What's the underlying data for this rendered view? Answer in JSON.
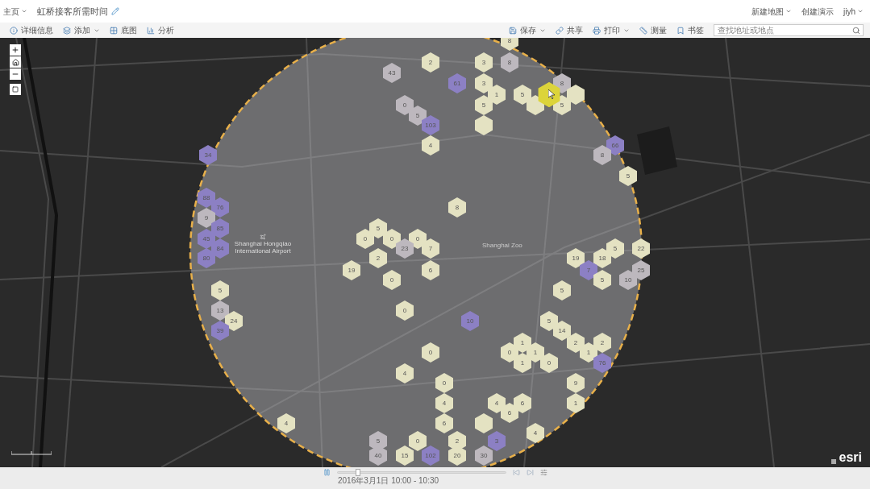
{
  "header": {
    "breadcrumb": "主页",
    "title": "虹桥接客所需时间",
    "menu": [
      {
        "label": "新建地图",
        "dropdown": true
      },
      {
        "label": "创建演示",
        "dropdown": false
      },
      {
        "label": "jiyh",
        "dropdown": true
      }
    ]
  },
  "toolbar": {
    "left": [
      {
        "label": "详细信息",
        "dropdown": false
      },
      {
        "label": "添加",
        "dropdown": true
      },
      {
        "label": "底图",
        "dropdown": false
      },
      {
        "label": "分析",
        "dropdown": false
      }
    ],
    "right": [
      {
        "label": "保存",
        "dropdown": true
      },
      {
        "label": "共享",
        "dropdown": false
      },
      {
        "label": "打印",
        "dropdown": true
      },
      {
        "label": "测量",
        "dropdown": false
      },
      {
        "label": "书签",
        "dropdown": false
      }
    ],
    "search": {
      "placeholder": "查找地址或地点"
    }
  },
  "map": {
    "labels": [
      {
        "text": "Shanghai Hongqiao International Airport",
        "kind": "poi"
      },
      {
        "text": "Shanghai Zoo",
        "kind": "small"
      }
    ],
    "hexes": [
      {
        "value": "8",
        "color": "#e4e2c2",
        "selected": false
      },
      {
        "value": "2",
        "color": "#e4e2c2",
        "selected": false
      },
      {
        "value": "3",
        "color": "#e4e2c2",
        "selected": false
      },
      {
        "value": "8",
        "color": "#bdb8be",
        "selected": false
      },
      {
        "value": "43",
        "color": "#bdb8be",
        "selected": false
      },
      {
        "value": "61",
        "color": "#8c80c4",
        "selected": false
      },
      {
        "value": "3",
        "color": "#e4e2c2",
        "selected": false
      },
      {
        "value": "8",
        "color": "#bdb8be",
        "selected": false
      },
      {
        "value": "1",
        "color": "#e4e2c2",
        "selected": false
      },
      {
        "value": "5",
        "color": "#e4e2c2",
        "selected": false
      },
      {
        "color": "#dcd43a",
        "selected": true
      },
      {
        "color": "#e4e2c2",
        "selected": false
      },
      {
        "value": "0",
        "color": "#bdb8be",
        "selected": false
      },
      {
        "value": "5",
        "color": "#e4e2c2",
        "selected": false
      },
      {
        "color": "#e4e2c2",
        "selected": false
      },
      {
        "value": "5",
        "color": "#e4e2c2",
        "selected": false
      },
      {
        "value": "5",
        "color": "#bdb8be",
        "selected": false
      },
      {
        "value": "103",
        "color": "#8c80c4",
        "selected": false
      },
      {
        "color": "#e4e2c2",
        "selected": false
      },
      {
        "value": "4",
        "color": "#e4e2c2",
        "selected": false
      },
      {
        "value": "66",
        "color": "#8c80c4",
        "selected": false
      },
      {
        "value": "34",
        "color": "#8c80c4",
        "selected": false
      },
      {
        "value": "8",
        "color": "#bdb8be",
        "selected": false
      },
      {
        "value": "5",
        "color": "#e4e2c2",
        "selected": false
      },
      {
        "value": "88",
        "color": "#8c80c4",
        "selected": false
      },
      {
        "value": "76",
        "color": "#8c80c4",
        "selected": false
      },
      {
        "value": "8",
        "color": "#e4e2c2",
        "selected": false
      },
      {
        "value": "9",
        "color": "#bdb8be",
        "selected": false
      },
      {
        "value": "85",
        "color": "#8c80c4",
        "selected": false
      },
      {
        "value": "5",
        "color": "#e4e2c2",
        "selected": false
      },
      {
        "value": "45",
        "color": "#8c80c4",
        "selected": false
      },
      {
        "value": "0",
        "color": "#e4e2c2",
        "selected": false
      },
      {
        "value": "0",
        "color": "#e4e2c2",
        "selected": false
      },
      {
        "value": "0",
        "color": "#e4e2c2",
        "selected": false
      },
      {
        "value": "84",
        "color": "#8c80c4",
        "selected": false
      },
      {
        "value": "23",
        "color": "#bdb8be",
        "selected": false
      },
      {
        "value": "7",
        "color": "#e4e2c2",
        "selected": false
      },
      {
        "value": "5",
        "color": "#e4e2c2",
        "selected": false
      },
      {
        "value": "22",
        "color": "#e4e2c2",
        "selected": false
      },
      {
        "value": "80",
        "color": "#8c80c4",
        "selected": false
      },
      {
        "value": "2",
        "color": "#e4e2c2",
        "selected": false
      },
      {
        "value": "19",
        "color": "#e4e2c2",
        "selected": false
      },
      {
        "value": "18",
        "color": "#e4e2c2",
        "selected": false
      },
      {
        "value": "19",
        "color": "#e4e2c2",
        "selected": false
      },
      {
        "value": "6",
        "color": "#e4e2c2",
        "selected": false
      },
      {
        "value": "7",
        "color": "#8c80c4",
        "selected": false
      },
      {
        "value": "25",
        "color": "#bdb8be",
        "selected": false
      },
      {
        "value": "0",
        "color": "#e4e2c2",
        "selected": false
      },
      {
        "value": "5",
        "color": "#e4e2c2",
        "selected": false
      },
      {
        "value": "10",
        "color": "#bdb8be",
        "selected": false
      },
      {
        "value": "5",
        "color": "#e4e2c2",
        "selected": false
      },
      {
        "value": "5",
        "color": "#e4e2c2",
        "selected": false
      },
      {
        "value": "13",
        "color": "#bdb8be",
        "selected": false
      },
      {
        "value": "0",
        "color": "#e4e2c2",
        "selected": false
      },
      {
        "value": "24",
        "color": "#e4e2c2",
        "selected": false
      },
      {
        "value": "10",
        "color": "#8c80c4",
        "selected": false
      },
      {
        "value": "5",
        "color": "#e4e2c2",
        "selected": false
      },
      {
        "value": "39",
        "color": "#8c80c4",
        "selected": false
      },
      {
        "value": "14",
        "color": "#e4e2c2",
        "selected": false
      },
      {
        "value": "1",
        "color": "#e4e2c2",
        "selected": false
      },
      {
        "value": "2",
        "color": "#e4e2c2",
        "selected": false
      },
      {
        "value": "2",
        "color": "#e4e2c2",
        "selected": false
      },
      {
        "value": "0",
        "color": "#e4e2c2",
        "selected": false
      },
      {
        "value": "0",
        "color": "#e4e2c2",
        "selected": false
      },
      {
        "value": "1",
        "color": "#e4e2c2",
        "selected": false
      },
      {
        "value": "1",
        "color": "#e4e2c2",
        "selected": false
      },
      {
        "value": "1",
        "color": "#e4e2c2",
        "selected": false
      },
      {
        "value": "0",
        "color": "#e4e2c2",
        "selected": false
      },
      {
        "value": "76",
        "color": "#8c80c4",
        "selected": false
      },
      {
        "value": "4",
        "color": "#e4e2c2",
        "selected": false
      },
      {
        "value": "0",
        "color": "#e4e2c2",
        "selected": false
      },
      {
        "value": "9",
        "color": "#e4e2c2",
        "selected": false
      },
      {
        "value": "4",
        "color": "#e4e2c2",
        "selected": false
      },
      {
        "value": "4",
        "color": "#e4e2c2",
        "selected": false
      },
      {
        "value": "6",
        "color": "#e4e2c2",
        "selected": false
      },
      {
        "value": "1",
        "color": "#e4e2c2",
        "selected": false
      },
      {
        "value": "6",
        "color": "#e4e2c2",
        "selected": false
      },
      {
        "value": "4",
        "color": "#e4e2c2",
        "selected": false
      },
      {
        "value": "6",
        "color": "#e4e2c2",
        "selected": false
      },
      {
        "color": "#e4e2c2",
        "selected": false
      },
      {
        "value": "4",
        "color": "#e4e2c2",
        "selected": false
      },
      {
        "value": "5",
        "color": "#bdb8be",
        "selected": false
      },
      {
        "value": "0",
        "color": "#e4e2c2",
        "selected": false
      },
      {
        "value": "2",
        "color": "#e4e2c2",
        "selected": false
      },
      {
        "value": "3",
        "color": "#8c80c4",
        "selected": false
      },
      {
        "value": "40",
        "color": "#bdb8be",
        "selected": false
      },
      {
        "value": "15",
        "color": "#e4e2c2",
        "selected": false
      },
      {
        "value": "102",
        "color": "#8c80c4",
        "selected": false
      },
      {
        "value": "20",
        "color": "#e4e2c2",
        "selected": false
      },
      {
        "value": "30",
        "color": "#bdb8be",
        "selected": false
      }
    ],
    "attribution": "esri"
  },
  "timeline": {
    "level": 0.11,
    "time": "2016年3月1日 10:00 - 10:30"
  }
}
